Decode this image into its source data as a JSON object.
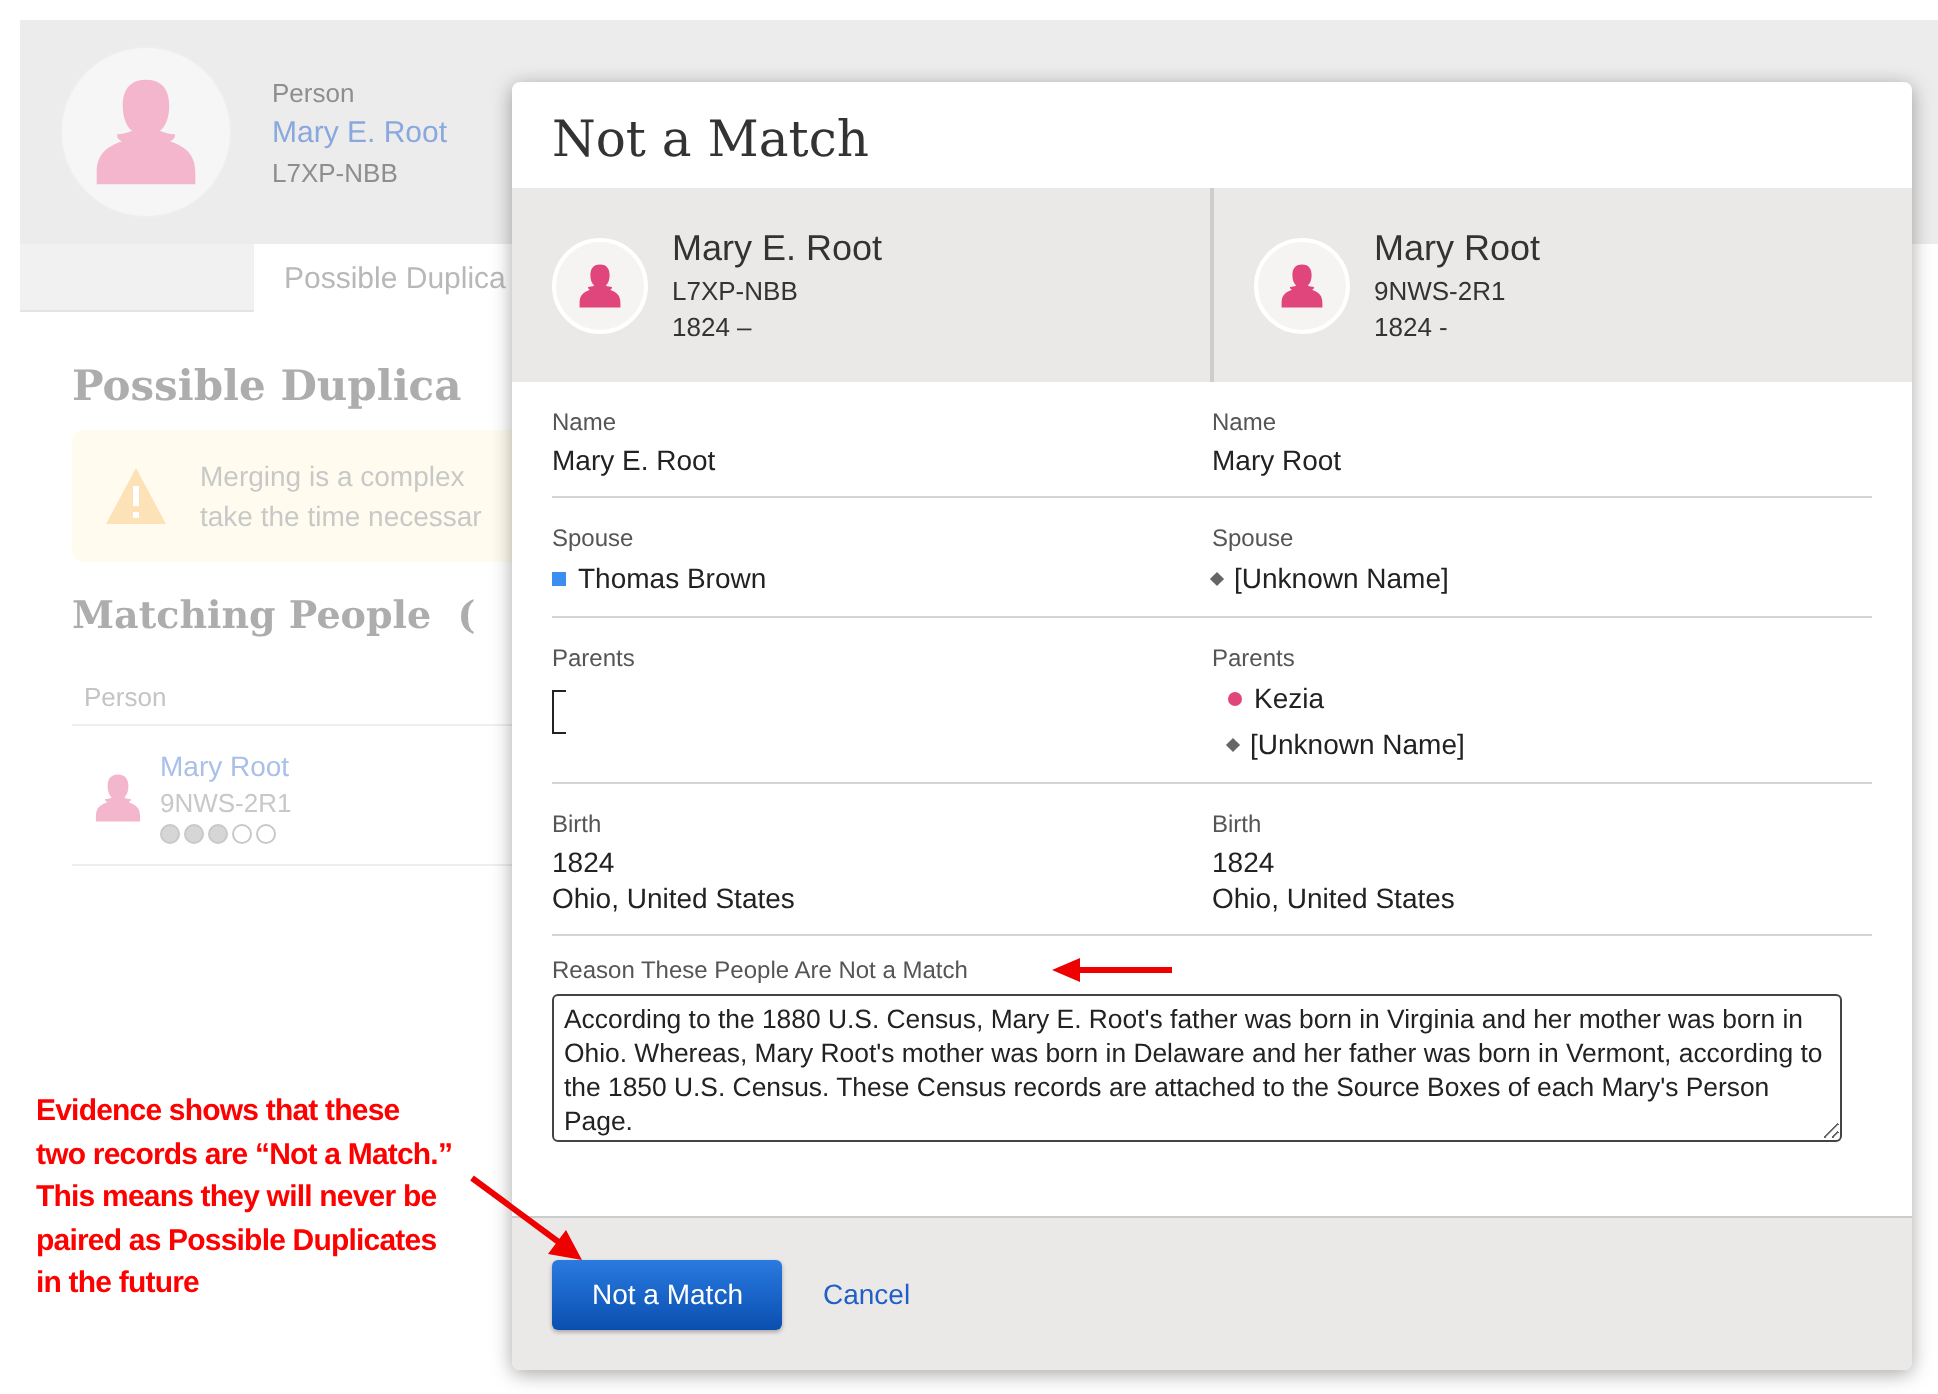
{
  "background": {
    "header": {
      "label": "Person",
      "name": "Mary E. Root",
      "id": "L7XP-NBB"
    },
    "tabs": [
      {
        "label": "Possible Duplica",
        "selected": true
      }
    ],
    "heading": "Possible Duplica",
    "warning": {
      "lines": [
        "Merging is a complex",
        "take the time necessar"
      ]
    },
    "section_heading": "Matching People  (",
    "table": {
      "columns": [
        "Person"
      ],
      "rows": [
        {
          "name": "Mary Root",
          "id": "9NWS-2R1",
          "stars": 3
        }
      ]
    }
  },
  "dialog": {
    "title": "Not a Match",
    "people": [
      {
        "name": "Mary E. Root",
        "id": "L7XP-NBB",
        "dates": "1824 –"
      },
      {
        "name": "Mary Root",
        "id": "9NWS-2R1",
        "dates": "1824 -"
      }
    ],
    "rows": [
      {
        "cells": [
          {
            "label": "Name",
            "kind": "text",
            "lines": [
              "Mary E. Root"
            ]
          },
          {
            "label": "Name",
            "kind": "text",
            "lines": [
              "Mary Root"
            ]
          }
        ]
      },
      {
        "cells": [
          {
            "label": "Spouse",
            "kind": "list",
            "items": [
              {
                "text": "Thomas Brown",
                "kind": "square",
                "color": "#3b8ef0"
              }
            ]
          },
          {
            "label": "Spouse",
            "kind": "list",
            "items": [
              {
                "text": "[Unknown Name]",
                "kind": "diamond",
                "color": "#666666"
              }
            ]
          }
        ]
      },
      {
        "cells": [
          {
            "label": "Parents",
            "kind": "empty"
          },
          {
            "label": "Parents",
            "kind": "list",
            "items": [
              {
                "text": "Kezia",
                "kind": "dot",
                "color": "#e0457b"
              },
              {
                "text": "[Unknown Name]",
                "kind": "diamond",
                "color": "#666666"
              }
            ]
          }
        ]
      },
      {
        "cells": [
          {
            "label": "Birth",
            "kind": "text",
            "lines": [
              "1824",
              "Ohio, United States"
            ]
          },
          {
            "label": "Birth",
            "kind": "text",
            "lines": [
              "1824",
              "Ohio, United States"
            ]
          }
        ]
      }
    ],
    "reason": {
      "label": "Reason These People Are Not a Match",
      "value": "According to the 1880 U.S. Census, Mary E. Root's father was born in Virginia and her mother was born in Ohio. Whereas, Mary Root's mother was born in Delaware and her father was born in Vermont, according to the 1850 U.S. Census. These Census records are attached to the Source Boxes of each Mary's Person Page."
    },
    "buttons": [
      {
        "label": "Not a Match",
        "kind": "primary"
      },
      {
        "label": "Cancel",
        "kind": "link"
      }
    ]
  },
  "annotation": {
    "lines": [
      "Evidence shows that these",
      "two records are “Not a Match.”",
      "This means they will never be",
      "paired as Possible Duplicates",
      "in the future"
    ]
  }
}
